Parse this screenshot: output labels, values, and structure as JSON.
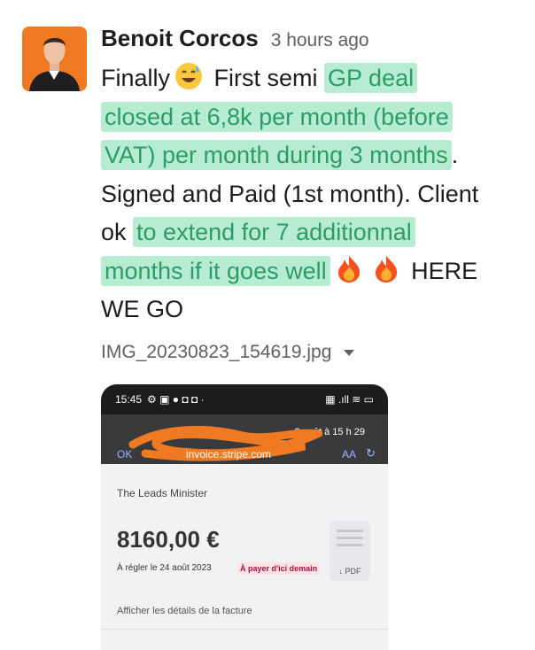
{
  "message": {
    "author": "Benoit Corcos",
    "timestamp": "3 hours ago",
    "body": {
      "line1_text": "Finally",
      "line1_text2": " First semi ",
      "hl1": "GP deal",
      "hl2": "closed at 6,8k per month (before",
      "hl3": "VAT) per month during 3 months",
      "after_hl3": ".",
      "line4": "Signed and Paid (1st month). Client",
      "line5_prefix": "ok ",
      "hl4": "to extend for 7 additionnal",
      "hl5": "months if it goes well",
      "tail": " HERE",
      "last_line": "WE GO"
    },
    "emoji": [
      "grinning-sweat-emoji",
      "fire-emoji",
      "fire-emoji"
    ]
  },
  "attachment": {
    "filename": "IMG_20230823_154619.jpg"
  },
  "screenshot": {
    "status_time": "15:45",
    "notification": "3 août à 15 h 29",
    "back_label": "OK",
    "url": "invoice.stripe.com",
    "text_size_label": "AA",
    "merchant": "The Leads Minister",
    "amount": "8160,00 €",
    "due": "À régler le 24 août 2023",
    "badge": "À payer d'ici demain",
    "pdf_label": "↓ PDF",
    "details_link": "Afficher les détails de la facture"
  },
  "colors": {
    "highlight_bg": "#b6ecd2",
    "highlight_text": "#2e9c64",
    "avatar_bg": "#f07a22"
  }
}
